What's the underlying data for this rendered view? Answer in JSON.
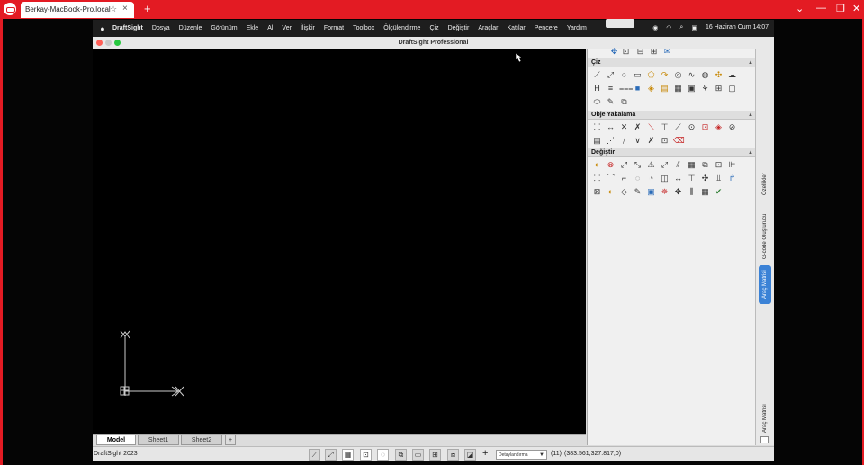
{
  "remote": {
    "tab_title": "Berkay-MacBook-Pro.local",
    "new_tab": "+",
    "window_controls": [
      "⌄",
      "—",
      "❐",
      "✕"
    ]
  },
  "menubar": {
    "app_name": "DraftSight",
    "items": [
      "Dosya",
      "Düzenle",
      "Görünüm",
      "Ekle",
      "Al",
      "Ver",
      "İlişkir",
      "Format",
      "Toolbox",
      "Ölçülendirme",
      "Çiz",
      "Değiştir",
      "Araçlar",
      "Katılar",
      "Pencere",
      "Yardım"
    ],
    "clock": "16 Haziran Cum  14:07"
  },
  "window": {
    "title": "DraftSight Professional"
  },
  "palette": {
    "sections": [
      {
        "label": "Çiz"
      },
      {
        "label": "Obje Yakalama"
      },
      {
        "label": "Değiştir"
      }
    ]
  },
  "side_tabs": {
    "ozellikler": "Özellikler",
    "gcode": "G-code Oluşturucu",
    "arac_matrisi_blue": "Araç Matrisi",
    "arac_matrisi_bottom": "Araç Matrisi"
  },
  "sheet_tabs": [
    "Model",
    "Sheet1",
    "Sheet2"
  ],
  "sheet_add": "+",
  "status": {
    "app_version": "DraftSight 2023",
    "workspace": "Detaylandırma",
    "count": "(11)",
    "coords": "(383.561,327.817,0)"
  },
  "colors": {
    "remote_accent": "#e31b23",
    "canvas": "#000000",
    "blue_tab": "#3b82d6"
  }
}
